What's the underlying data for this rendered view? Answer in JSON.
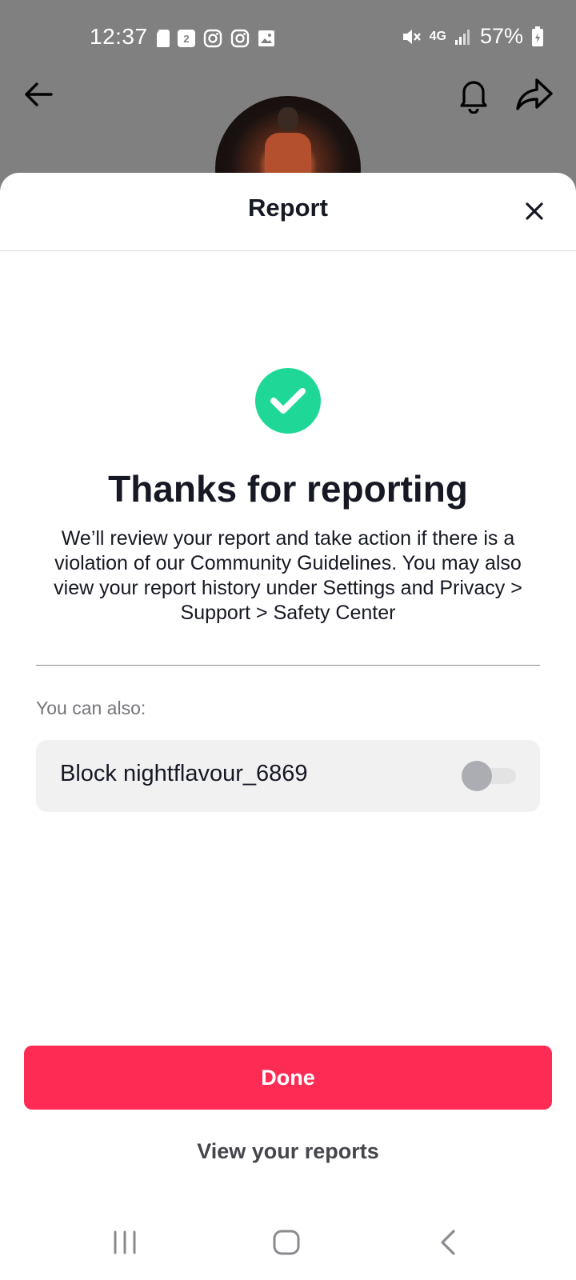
{
  "status_bar": {
    "time": "12:37",
    "calendar_badge": "2",
    "network": "4G",
    "battery": "57%"
  },
  "sheet": {
    "title": "Report",
    "heading": "Thanks for reporting",
    "description": "We’ll review your report and take action if there is a violation of our Community Guidelines. You may also view your report history under Settings and Privacy > Support > Safety Center",
    "also_label": "You can also:",
    "block_label": "Block nightflavour_6869",
    "block_toggle_on": false,
    "done_label": "Done",
    "view_reports_label": "View your reports"
  },
  "colors": {
    "accent": "#fe2c55",
    "success": "#1fd898",
    "text": "#161823"
  },
  "icons": [
    "back-arrow-icon",
    "bell-icon",
    "share-icon",
    "close-icon",
    "checkmark-icon",
    "recent-apps-icon",
    "home-icon",
    "nav-back-icon"
  ]
}
